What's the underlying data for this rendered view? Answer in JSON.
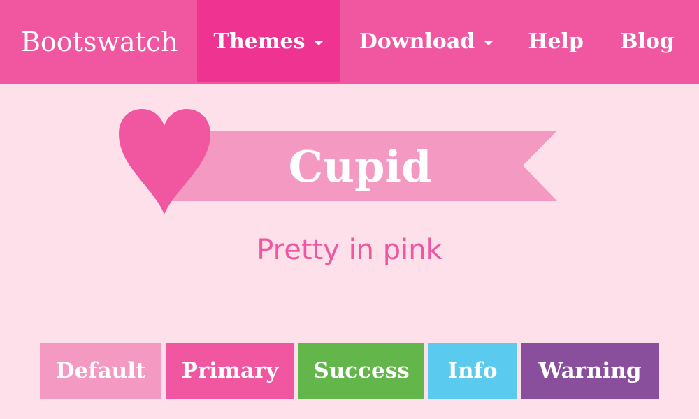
{
  "navbar": {
    "brand": "Bootswatch",
    "items": [
      {
        "label": "Themes",
        "dropdown": true,
        "active": true
      },
      {
        "label": "Download",
        "dropdown": true,
        "active": false
      },
      {
        "label": "Help",
        "dropdown": false,
        "active": false
      },
      {
        "label": "Blog",
        "dropdown": false,
        "active": false
      }
    ]
  },
  "hero": {
    "title": "Cupid",
    "subtitle": "Pretty in pink",
    "icons": [
      "heart-icon",
      "ribbon-banner"
    ]
  },
  "buttons": [
    {
      "label": "Default",
      "color": "#f499c2"
    },
    {
      "label": "Primary",
      "color": "#f057a0"
    },
    {
      "label": "Success",
      "color": "#63b64a"
    },
    {
      "label": "Info",
      "color": "#5bcaef"
    },
    {
      "label": "Warning",
      "color": "#894f9d"
    }
  ],
  "colors": {
    "background": "#fde0ea",
    "navbar": "#f057a0",
    "navbar_active": "#ee3390",
    "ribbon": "#f499c2",
    "heart": "#f057a0",
    "subtitle": "#ef57a0"
  }
}
